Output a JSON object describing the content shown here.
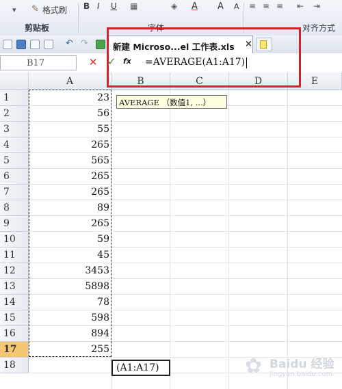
{
  "ribbon": {
    "format_painter": "格式刷",
    "clipboard_group": "剪贴板",
    "font_group": "字体",
    "align_group": "对齐方式"
  },
  "tab": {
    "label": "新建 Microso...el 工作表.xls",
    "close": "×"
  },
  "formula_bar": {
    "name_box": "B17",
    "cancel": "✕",
    "enter": "✓",
    "fx": "fx",
    "formula": "=AVERAGE(A1:A17)"
  },
  "grid": {
    "columns": [
      "A",
      "B",
      "C",
      "D",
      "E"
    ],
    "rows": [
      "1",
      "2",
      "3",
      "4",
      "5",
      "6",
      "7",
      "8",
      "9",
      "10",
      "11",
      "12",
      "13",
      "14",
      "15",
      "16",
      "17",
      "18"
    ],
    "column_a_values": [
      "23",
      "56",
      "55",
      "265",
      "565",
      "265",
      "265",
      "89",
      "265",
      "59",
      "45",
      "3453",
      "5898",
      "78",
      "598",
      "894",
      "255"
    ],
    "selected_row": "17",
    "active_cell_text": "(A1:A17)"
  },
  "tooltip": {
    "text": "AVERAGE （数值1, ...）"
  },
  "watermark": {
    "name": "Baidu 经验",
    "sub": "jingyan.baidu.com"
  },
  "colors": {
    "highlight": "#d0242a",
    "selected_row": "#f5c773",
    "tooltip_bg": "#ffffe1"
  }
}
